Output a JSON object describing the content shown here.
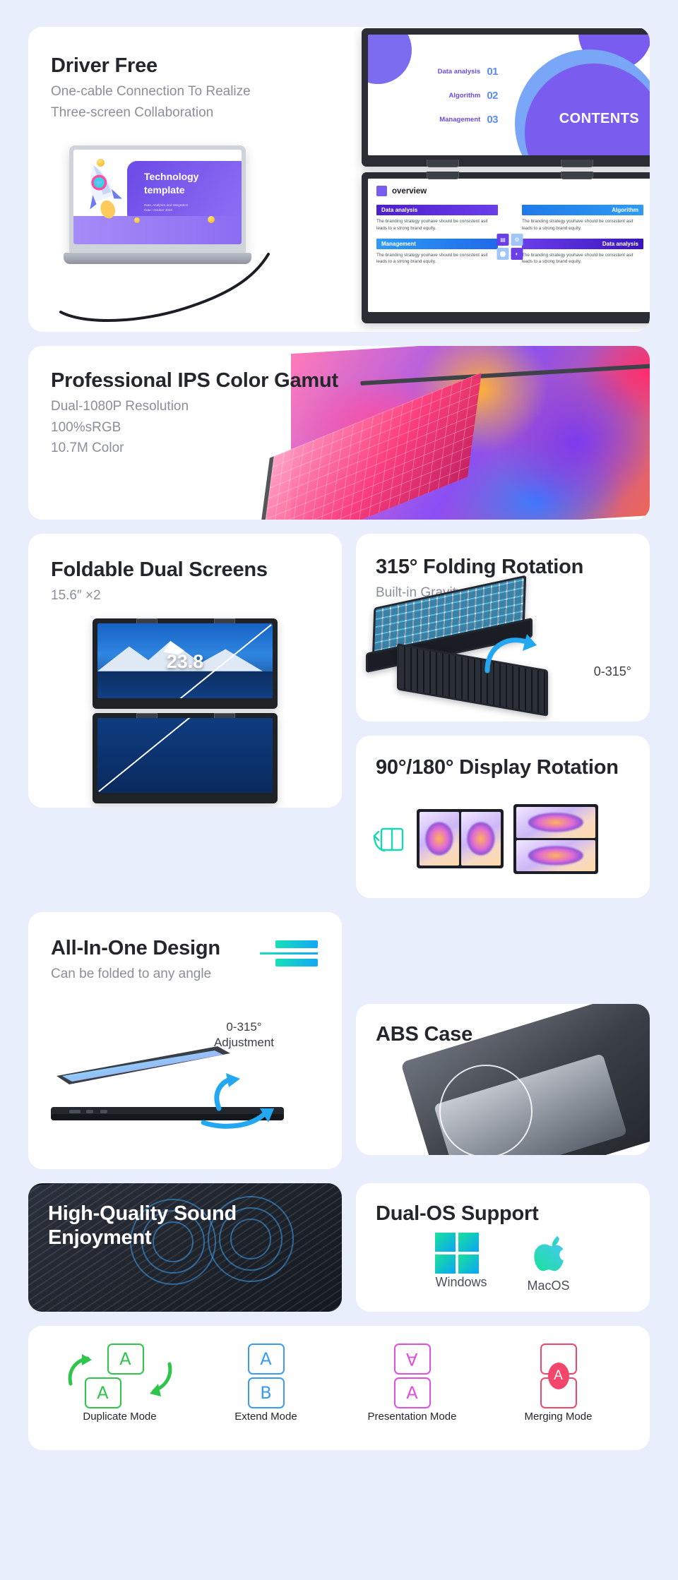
{
  "theme": {
    "page_bg": "#e8eefc",
    "card_bg": "#ffffff",
    "title_color": "#23262b",
    "sub_color": "#8a8f98"
  },
  "cards": {
    "driver_free": {
      "title": "Driver Free",
      "subtitle_line1": "One-cable Connection To Realize",
      "subtitle_line2": "Three-screen Collaboration",
      "monitor_slide_top": {
        "contents_word": "CONTENTS",
        "toc": [
          {
            "label": "Data analysis",
            "num": "01"
          },
          {
            "label": "Algorithm",
            "num": "02"
          },
          {
            "label": "Management",
            "num": "03"
          }
        ]
      },
      "monitor_slide_bottom": {
        "header": "overview",
        "blocks": [
          {
            "heading": "Data analysis",
            "body": "The branding strategy youhave should be consistent asit leads to a strong brand equity."
          },
          {
            "heading": "Algorithm",
            "body": "The branding strategy youhave should be consistent asit leads to a strong brand equity."
          },
          {
            "heading": "Management",
            "body": "The branding strategy youhave should be consistent asit leads to a strong brand equity."
          },
          {
            "heading": "Data analysis",
            "body": "The branding strategy youhave should be consistent asit leads to a strong brand equity."
          }
        ]
      },
      "laptop_slide": {
        "title_line1": "Technology",
        "title_line2": "template",
        "meta_line1": "Data, Analytics and Integration",
        "meta_line2": "Date: October 2020"
      }
    },
    "ips": {
      "title": "Professional IPS Color Gamut",
      "spec1": "Dual-1080P Resolution",
      "spec2": "100%sRGB",
      "spec3": "10.7M Color"
    },
    "foldable": {
      "title": "Foldable Dual Screens",
      "subtitle": "15.6″ ×2",
      "screen_size_label": "23.8"
    },
    "folding_315": {
      "title": "315° Folding Rotation",
      "subtitle": "Built-in Gravity Sensor",
      "angle_label": "0-315°"
    },
    "all_in_one": {
      "title": "All-In-One Design",
      "subtitle": "Can be folded to any angle",
      "adjust_line1": "0-315°",
      "adjust_line2": "Adjustment"
    },
    "display_rotation": {
      "title": "90°/180° Display Rotation"
    },
    "abs_case": {
      "title": "ABS Case"
    },
    "sound": {
      "title_line1": "High-Quality Sound",
      "title_line2": "Enjoyment"
    },
    "dual_os": {
      "title": "Dual-OS Support",
      "os": [
        {
          "name": "Windows",
          "icon": "windows-logo"
        },
        {
          "name": "MacOS",
          "icon": "apple-logo"
        }
      ]
    },
    "modes": {
      "items": [
        {
          "label": "Duplicate Mode",
          "top_glyph": "A",
          "bottom_glyph": "A",
          "color": "#2fc44a",
          "icon": "duplicate-mode-icon"
        },
        {
          "label": "Extend Mode",
          "top_glyph": "A",
          "bottom_glyph": "B",
          "color": "#3b9bf0",
          "icon": "extend-mode-icon"
        },
        {
          "label": "Presentation Mode",
          "top_glyph": "A",
          "bottom_glyph": "A",
          "color": "#e04fe0",
          "icon": "presentation-mode-icon"
        },
        {
          "label": "Merging Mode",
          "top_glyph": "",
          "bottom_glyph": "",
          "badge_glyph": "A",
          "color": "#f2476b",
          "icon": "merging-mode-icon"
        }
      ]
    }
  }
}
